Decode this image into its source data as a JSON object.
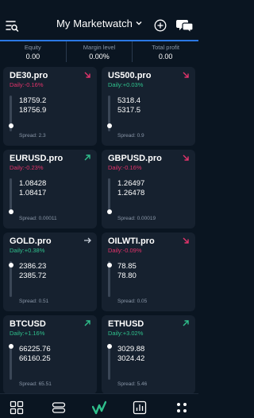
{
  "header": {
    "title": "My Marketwatch",
    "icons": [
      "filter-list-icon",
      "chevron-down-icon",
      "plus-circle-icon",
      "chat-icon"
    ]
  },
  "stats": [
    {
      "label": "Equity",
      "value": "0.00"
    },
    {
      "label": "Margin level",
      "value": "0.00%"
    },
    {
      "label": "Total profit",
      "value": "0.00"
    }
  ],
  "instruments": [
    {
      "symbol": "DE30.pro",
      "daily": "Daily:-0.16%",
      "trend": "down",
      "bid": "18759.2",
      "ask": "18756.9",
      "spread": "Spread: 2.3",
      "level": 0.1
    },
    {
      "symbol": "US500.pro",
      "daily": "Daily:+0.03%",
      "trend": "down",
      "bid": "5318.4",
      "ask": "5317.5",
      "spread": "Spread: 0.9",
      "level": 0.1
    },
    {
      "symbol": "EURUSD.pro",
      "daily": "Daily:-0.23%",
      "trend": "up",
      "bid": "1.08428",
      "ask": "1.08417",
      "spread": "Spread: 0.00011",
      "level": 0.0
    },
    {
      "symbol": "GBPUSD.pro",
      "daily": "Daily:-0.16%",
      "trend": "down",
      "bid": "1.26497",
      "ask": "1.26478",
      "spread": "Spread: 0.00019",
      "level": 0.0
    },
    {
      "symbol": "GOLD.pro",
      "daily": "Daily:+0.38%",
      "trend": "flat",
      "bid": "2386.23",
      "ask": "2385.72",
      "spread": "Spread: 0.51",
      "level": 0.95
    },
    {
      "symbol": "OILWTI.pro",
      "daily": "Daily:-0.09%",
      "trend": "down",
      "bid": "78.85",
      "ask": "78.80",
      "spread": "Spread: 0.05",
      "level": 0.95
    },
    {
      "symbol": "BTCUSD",
      "daily": "Daily:+1.16%",
      "trend": "up",
      "bid": "66225.76",
      "ask": "66160.25",
      "spread": "Spread: 65.51",
      "level": 1.0
    },
    {
      "symbol": "ETHUSD",
      "daily": "Daily:+3.02%",
      "trend": "up",
      "bid": "3029.88",
      "ask": "3024.42",
      "spread": "Spread: 5.46",
      "level": 1.0
    }
  ],
  "bottom_nav": [
    "dashboard-grid-icon",
    "accounts-stack-icon",
    "markets-logo-icon",
    "reports-chart-icon",
    "more-dots-icon"
  ],
  "colors": {
    "background": "#0a1521",
    "card": "#16212f",
    "accent": "#2b78e4",
    "negative": "#e2336b",
    "positive": "#2fc08c"
  }
}
